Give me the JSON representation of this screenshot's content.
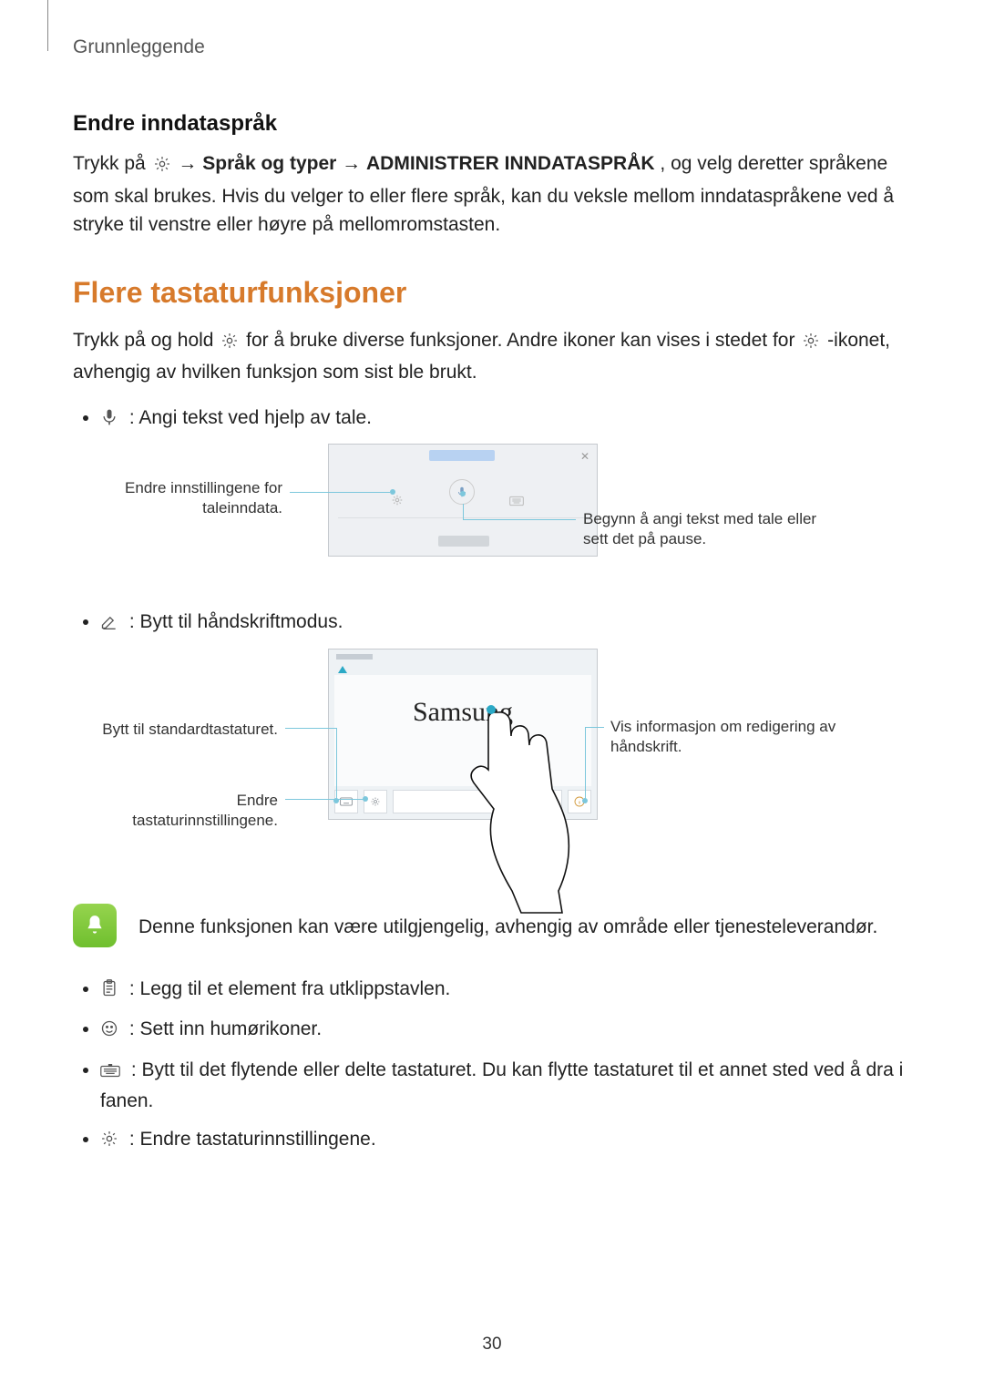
{
  "header": {
    "title": "Grunnleggende"
  },
  "section1": {
    "heading": "Endre inndataspråk",
    "p_parts": {
      "a": "Trykk på ",
      "b": " → ",
      "c": "Språk og typer",
      "d": " → ",
      "e": "ADMINISTRER INNDATASPRÅK",
      "f": ", og velg deretter språkene som skal brukes. Hvis du velger to eller flere språk, kan du veksle mellom inndataspråkene ved å stryke til venstre eller høyre på mellomromstasten."
    }
  },
  "section2": {
    "heading": "Flere tastaturfunksjoner",
    "intro_parts": {
      "a": "Trykk på og hold ",
      "b": " for å bruke diverse funksjoner. Andre ikoner kan vises i stedet for ",
      "c": "-ikonet, avhengig av hvilken funksjon som sist ble brukt."
    },
    "bullets": {
      "mic": " : Angi tekst ved hjelp av tale.",
      "pen": " : Bytt til håndskriftmodus.",
      "clipboard": " : Legg til et element fra utklippstavlen.",
      "smile": " : Sett inn humørikoner.",
      "floatkb": " : Bytt til det flytende eller delte tastaturet. Du kan flytte tastaturet til et annet sted ved å dra i fanen.",
      "gear": " : Endre tastaturinnstillingene."
    }
  },
  "fig1": {
    "left_label": "Endre innstillingene for taleinndata.",
    "right_label": "Begynn å angi tekst med tale eller sett det på pause."
  },
  "fig2": {
    "canvas_text": "Samsung",
    "labels": {
      "left_top": "Bytt til standardtastaturet.",
      "left_bottom": "Endre tastaturinnstillingene.",
      "right": "Vis informasjon om redigering av håndskrift."
    }
  },
  "note": {
    "text": "Denne funksjonen kan være utilgjengelig, avhengig av område eller tjenesteleverandør."
  },
  "page_number": "30"
}
